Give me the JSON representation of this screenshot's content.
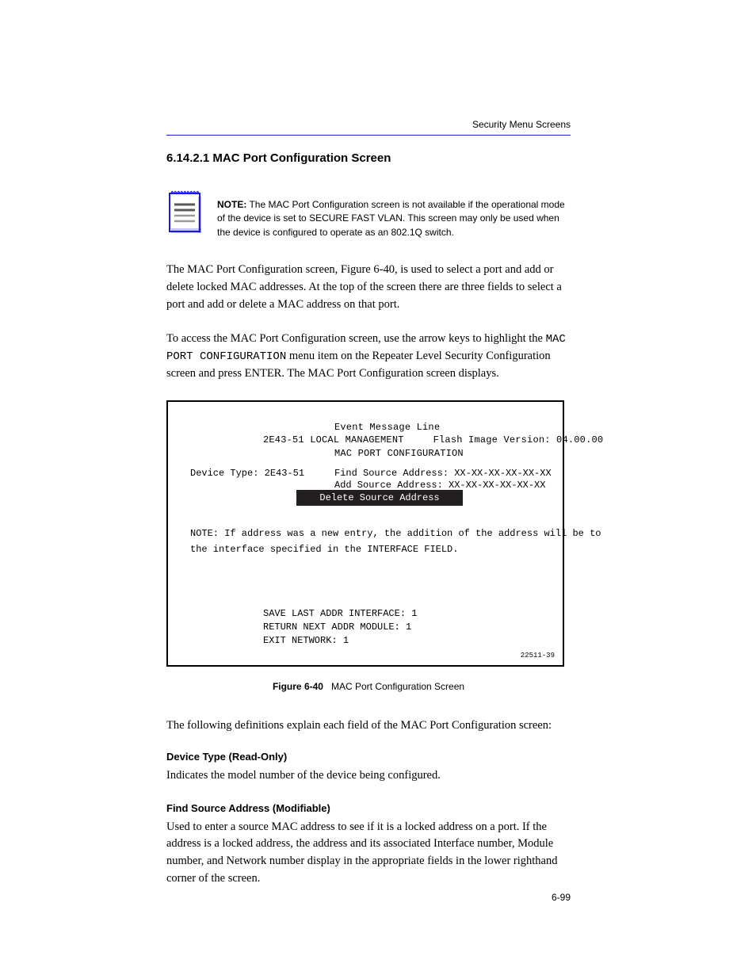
{
  "header": {
    "right": "Security Menu Screens"
  },
  "section": {
    "number": "6.14.2.1   MAC Port Configuration Screen"
  },
  "note": {
    "bold": "NOTE:",
    "text": "The MAC Port Configuration screen is not available if the operational mode of the device is set to SECURE FAST VLAN. This screen may only be used when the device is configured to operate as an 802.1Q switch."
  },
  "body": {
    "intro1": "The MAC Port Configuration screen, Figure 6-40, is used to select a port and add or delete locked MAC addresses. At the top of the screen there are three fields to select a port and add or delete a MAC address on that port.",
    "intro2_a": "To access the MAC Port Configuration screen, use the arrow keys to highlight the ",
    "intro2_cmd": "MAC PORT CONFIGURATION",
    "intro2_b": " menu item on the Repeater Level Security Configuration screen and press ENTER. The MAC Port Configuration screen displays."
  },
  "screen": {
    "title": "Event Message Line\n2E43-51 LOCAL MANAGEMENT     Flash Image Version: 04.00.00",
    "topline1": "         MAC PORT CONFIGURATION",
    "dev_type": "Device Type:  2E43-51",
    "find": "Find Source Address:  XX-XX-XX-XX-XX-XX",
    "add": "Add Source Address:   XX-XX-XX-XX-XX-XX",
    "highlight": "Delete Source Address",
    "note1": "NOTE: If address was a new entry, the addition of the address will be to",
    "note2": "the interface specified in the INTERFACE FIELD.",
    "save": "SAVE                LAST ADDR          INTERFACE:   1",
    "return": "RETURN              NEXT ADDR          MODULE:      1",
    "exit": "EXIT                                   NETWORK:     1"
  },
  "figure": {
    "label": "Figure 6-40",
    "caption": "MAC Port Configuration Screen"
  },
  "fields": {
    "following": "The following definitions explain each field of the MAC Port Configuration screen:",
    "device_type": {
      "label": "Device Type (Read-Only)",
      "body": "Indicates the model number of the device being configured."
    },
    "find": {
      "label": "Find Source Address (Modifiable)",
      "body": "Used to enter a source MAC address to see if it is a locked address on a port. If the address is a locked address, the address and its associated Interface number, Module number, and Network number display in the appropriate fields in the lower righthand corner of the screen."
    }
  },
  "page_number": "6-99"
}
